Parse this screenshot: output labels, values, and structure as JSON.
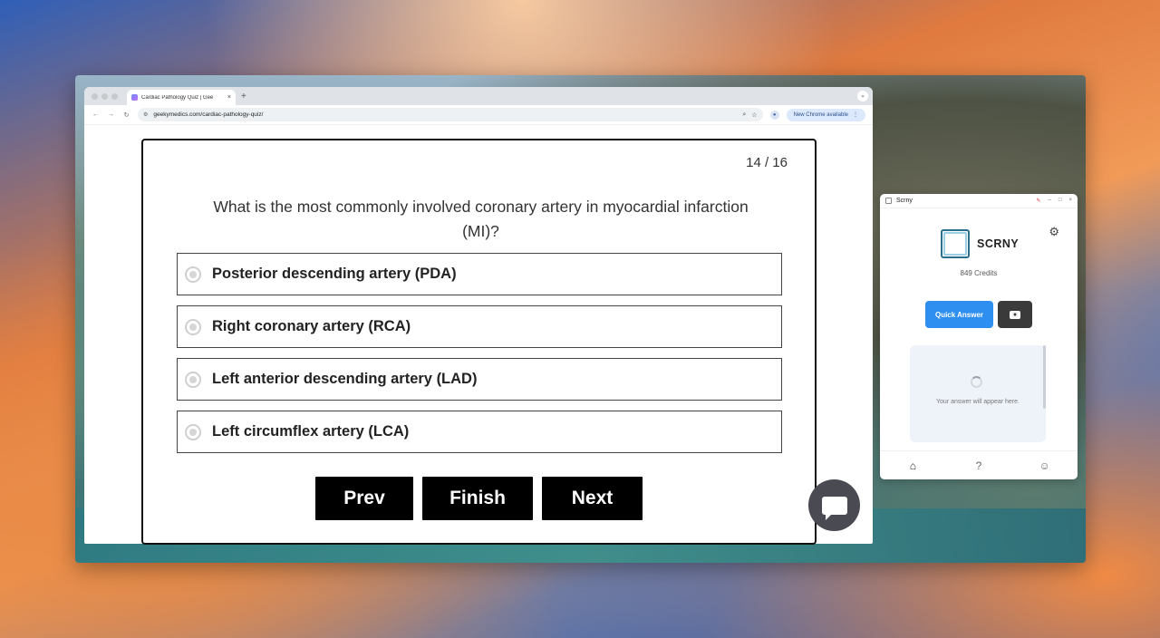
{
  "browser": {
    "tab_title": "Cardiac Pathology Quiz | Gee",
    "tab_close": "×",
    "new_tab": "+",
    "url": "geekymedics.com/cardiac-pathology-quiz/",
    "update_label": "New Chrome available",
    "icons": {
      "back": "back-arrow-icon",
      "forward": "forward-arrow-icon",
      "reload": "reload-icon",
      "zoom": "zoom-icon",
      "bookmark": "star-icon",
      "profile": "profile-icon",
      "menu": "kebab-menu-icon"
    }
  },
  "quiz": {
    "counter": "14 / 16",
    "question": "What is the most commonly involved coronary artery in myocardial infarction (MI)?",
    "options": [
      {
        "label": "Posterior descending artery (PDA)"
      },
      {
        "label": "Right coronary artery (RCA)"
      },
      {
        "label": "Left anterior descending artery (LAD)"
      },
      {
        "label": "Left circumflex artery (LCA)"
      }
    ],
    "buttons": {
      "prev": "Prev",
      "finish": "Finish",
      "next": "Next"
    }
  },
  "scrny": {
    "window_title": "Scrny",
    "brand": "SCRNY",
    "credits": "849 Credits",
    "quick_answer": "Quick Answer",
    "answer_placeholder": "Your answer will appear here.",
    "accent": "#2f8ff0"
  }
}
